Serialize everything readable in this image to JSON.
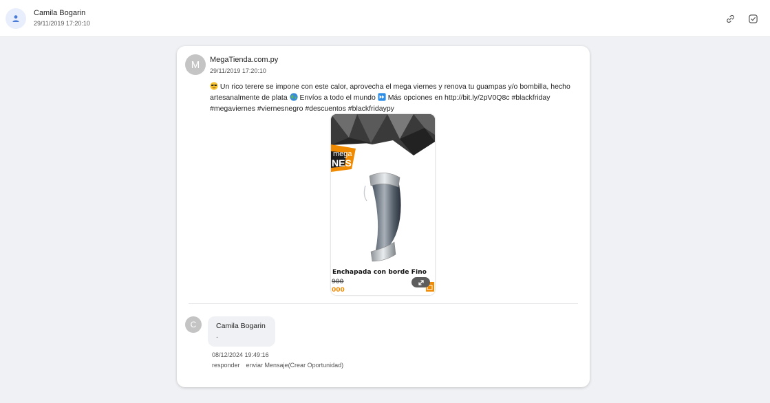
{
  "header": {
    "user_name": "Camila Bogarin",
    "timestamp": "29/11/2019 17:20:10",
    "icons": [
      "link-icon",
      "check-square-icon"
    ]
  },
  "post": {
    "avatar_letter": "M",
    "author": "MegaTienda.com.py",
    "timestamp": "29/11/2019 17:20:10",
    "text_part1": "Un rico terere se impone con este calor, aprovecha el mega viernes y renova tu guampas y/o bombilla, hecho artesanalmente de plata",
    "text_part2": "Envíos a todo el mundo",
    "text_part3": "Más opciones en http://bit.ly/2pV0Q8c #blackfriday #megaviernes #viernesnegro #descuentos #blackfridaypy",
    "image": {
      "banner_line1": "mega",
      "banner_line2": "NES",
      "caption": "Enchapada con borde Fino",
      "old_price": "900",
      "new_price": "000"
    }
  },
  "comment": {
    "avatar_letter": "C",
    "author": "Camila Bogarin",
    "text": ".",
    "timestamp": "08/12/2024 19:49:16",
    "reply_label": "responder",
    "message_label": "enviar Mensaje(Crear Oportunidad)"
  },
  "colors": {
    "accent": "#4a7bd8",
    "banner_orange": "#f08a00",
    "page_bg": "#f0f1f4"
  }
}
